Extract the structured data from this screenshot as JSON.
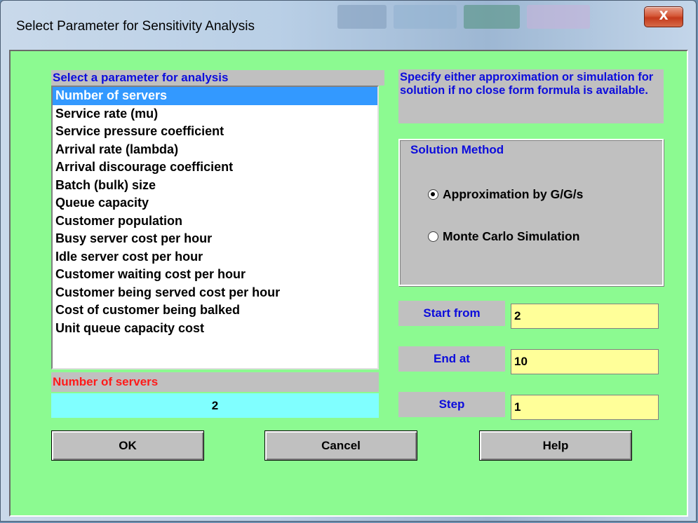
{
  "window": {
    "title": "Select Parameter for Sensitivity Analysis",
    "close_label": "X"
  },
  "list": {
    "label": "Select a parameter for analysis",
    "items": [
      "Number of servers",
      "Service rate (mu)",
      "Service pressure coefficient",
      "Arrival rate (lambda)",
      "Arrival discourage coefficient",
      "Batch (bulk) size",
      "Queue capacity",
      "Customer population",
      "Busy server cost per hour",
      "Idle server cost per hour",
      "Customer waiting cost per hour",
      "Customer being served cost per hour",
      "Cost of customer being balked",
      "Unit queue capacity cost"
    ],
    "selected_index": 0
  },
  "selected_param": {
    "name": "Number of servers",
    "value": "2"
  },
  "hint_text": "Specify either approximation or simulation for solution if no close form formula is available.",
  "solution_method": {
    "title": "Solution Method",
    "options": [
      {
        "label": "Approximation by G/G/s",
        "checked": true
      },
      {
        "label": "Monte Carlo Simulation",
        "checked": false
      }
    ]
  },
  "range": {
    "start_label": "Start from",
    "start_value": "2",
    "end_label": "End at",
    "end_value": "10",
    "step_label": "Step",
    "step_value": "1"
  },
  "buttons": {
    "ok": "OK",
    "cancel": "Cancel",
    "help": "Help"
  },
  "colors": {
    "dialog_bg": "#8cfa91",
    "label_blue": "#0c0cdc",
    "param_name_red": "#ff1a1a",
    "value_cyan": "#80ffff",
    "input_yellow": "#ffff99",
    "selection_blue": "#3399ff"
  }
}
